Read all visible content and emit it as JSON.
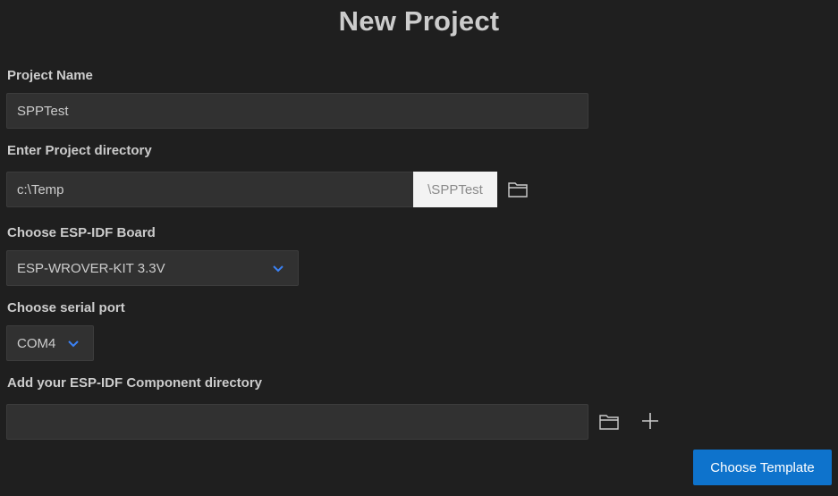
{
  "page": {
    "title": "New Project"
  },
  "project_name": {
    "label": "Project Name",
    "value": "SPPTest"
  },
  "project_directory": {
    "label": "Enter Project directory",
    "value": "c:\\Temp",
    "suffix": "\\SPPTest",
    "browse_icon": "folder-icon"
  },
  "board": {
    "label": "Choose ESP-IDF Board",
    "selected": "ESP-WROVER-KIT 3.3V",
    "icon": "chevron-down-icon"
  },
  "serial_port": {
    "label": "Choose serial port",
    "selected": "COM4",
    "icon": "chevron-down-icon"
  },
  "component_directory": {
    "label": "Add your ESP-IDF Component directory",
    "value": "",
    "browse_icon": "folder-icon",
    "add_icon": "plus-icon"
  },
  "actions": {
    "choose_template": "Choose Template"
  },
  "colors": {
    "background": "#1f1f1f",
    "input_bg": "#313131",
    "accent": "#0e73cc",
    "chevron": "#3b82f6"
  }
}
